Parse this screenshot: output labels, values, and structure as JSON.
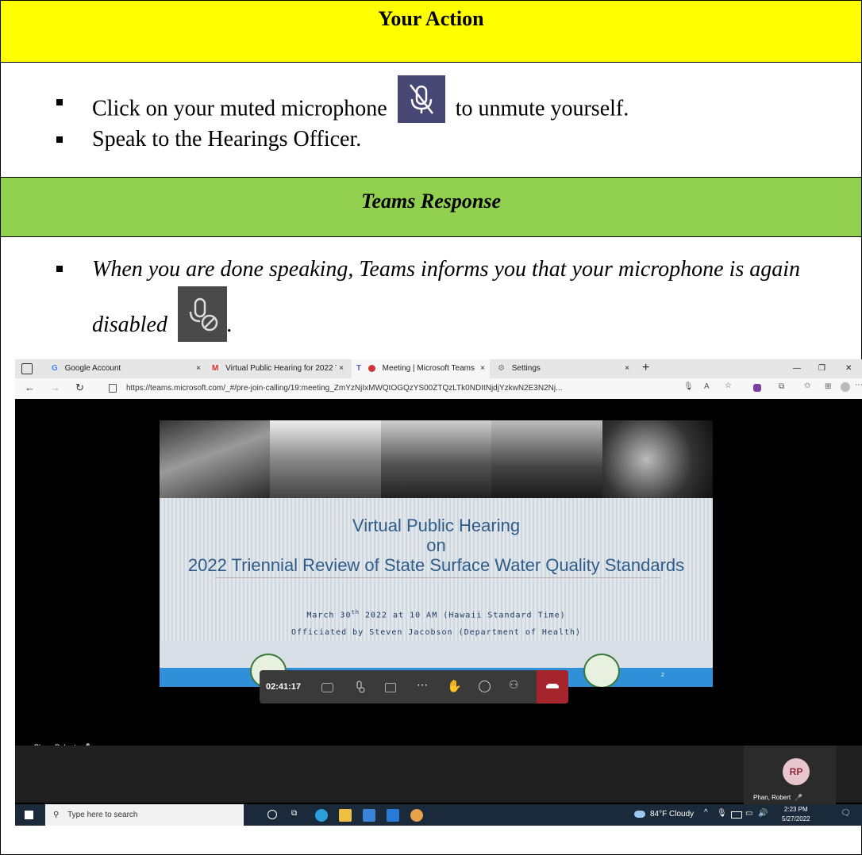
{
  "action": {
    "header": "Your Action",
    "bullet1_before": "Click on your muted microphone",
    "bullet1_after": "to unmute yourself.",
    "bullet2": "Speak to the Hearings Officer."
  },
  "response": {
    "header": "Teams Response",
    "bullet_before": "When you are done speaking, Teams informs you that your microphone is again disabled",
    "bullet_after": "."
  },
  "screenshot": {
    "tabs": [
      {
        "label": "Google Account"
      },
      {
        "label": "Virtual Public Hearing for 2022 T"
      },
      {
        "label": "Meeting | Microsoft Teams"
      },
      {
        "label": "Settings"
      }
    ],
    "tab_close": "×",
    "new_tab": "+",
    "url": "https://teams.microsoft.com/_#/pre-join-calling/19:meeting_ZmYzNjIxMWQtOGQzYS00ZTQzLTk0NDItNjdjYzkwN2E3N2Nj...",
    "slide": {
      "title1": "Virtual Public Hearing",
      "title2": "on",
      "title3": "2022 Triennial Review of State Surface Water Quality Standards",
      "sub1_pre": "March 30",
      "sub1_sup": "th",
      "sub1_post": " 2022 at 10 AM (Hawaii Standard Time)",
      "sub2": "Officiated by Steven Jacobson (Department of Health)",
      "page_num": "2"
    },
    "call": {
      "timer": "02:41:17",
      "participant_label": "Phan, Robert",
      "avatar_initials": "RP",
      "tile_name": "Phan, Robert"
    },
    "taskbar": {
      "search_placeholder": "Type here to search",
      "weather": "84°F  Cloudy",
      "time": "2:23 PM",
      "date": "5/27/2022"
    }
  }
}
